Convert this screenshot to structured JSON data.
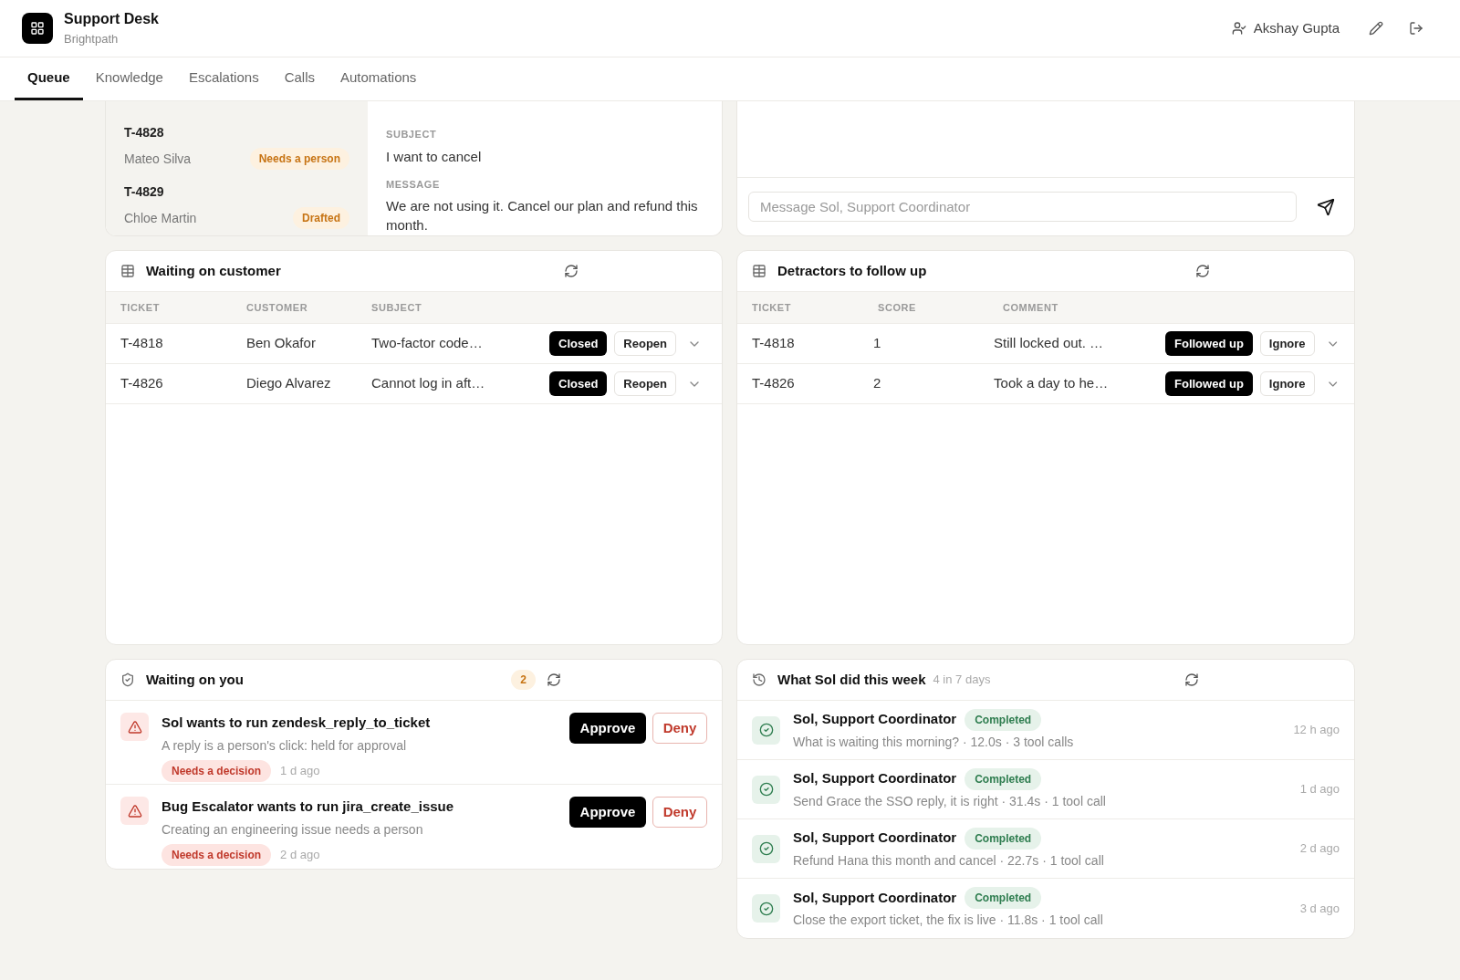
{
  "app": {
    "title": "Support Desk",
    "subtitle": "Brightpath"
  },
  "user": {
    "name": "Akshay Gupta"
  },
  "tabs": [
    {
      "label": "Queue",
      "selected": true
    },
    {
      "label": "Knowledge",
      "selected": false
    },
    {
      "label": "Escalations",
      "selected": false
    },
    {
      "label": "Calls",
      "selected": false
    },
    {
      "label": "Automations",
      "selected": false
    }
  ],
  "ticket_list": [
    {
      "id": "T-4828",
      "customer": "Mateo Silva",
      "status": "Needs a person"
    },
    {
      "id": "T-4829",
      "customer": "Chloe Martin",
      "status": "Drafted"
    }
  ],
  "ticket_detail": {
    "fields": [
      {
        "label": "SUBJECT",
        "value": "I want to cancel"
      },
      {
        "label": "MESSAGE",
        "value": "We are not using it. Cancel our plan and refund this month."
      }
    ]
  },
  "chat": {
    "placeholder": "Message Sol, Support Coordinator"
  },
  "tables": [
    {
      "title": "Waiting on customer",
      "columns": [
        "TICKET",
        "CUSTOMER",
        "SUBJECT"
      ],
      "rows": [
        {
          "cells": [
            "T-4818",
            "Ben Okafor",
            "Two-factor code…"
          ],
          "status": "Closed",
          "action": "Reopen"
        },
        {
          "cells": [
            "T-4826",
            "Diego Alvarez",
            "Cannot log in aft…"
          ],
          "status": "Closed",
          "action": "Reopen"
        }
      ]
    },
    {
      "title": "Detractors to follow up",
      "columns": [
        "TICKET",
        "SCORE",
        "COMMENT"
      ],
      "rows": [
        {
          "cells": [
            "T-4818",
            "1",
            "Still locked out. …"
          ],
          "status": "Followed up",
          "action": "Ignore"
        },
        {
          "cells": [
            "T-4826",
            "2",
            "Took a day to he…"
          ],
          "status": "Followed up",
          "action": "Ignore"
        }
      ]
    }
  ],
  "waiting_on_you": {
    "title": "Waiting on you",
    "count": "2",
    "items": [
      {
        "title": "Sol wants to run zendesk_reply_to_ticket",
        "description": "A reply is a person's click: held for approval",
        "tag": "Needs a decision",
        "time": "1 d ago",
        "approve": "Approve",
        "deny": "Deny"
      },
      {
        "title": "Bug Escalator wants to run jira_create_issue",
        "description": "Creating an engineering issue needs a person",
        "tag": "Needs a decision",
        "time": "2 d ago",
        "approve": "Approve",
        "deny": "Deny"
      }
    ]
  },
  "activity": {
    "title": "What Sol did this week",
    "summary": "4 in 7 days",
    "items": [
      {
        "agent": "Sol, Support Coordinator",
        "status": "Completed",
        "detail": "What is waiting this morning? · 12.0s · 3 tool calls",
        "time": "12 h ago"
      },
      {
        "agent": "Sol, Support Coordinator",
        "status": "Completed",
        "detail": "Send Grace the SSO reply, it is right · 31.4s · 1 tool call",
        "time": "1 d ago"
      },
      {
        "agent": "Sol, Support Coordinator",
        "status": "Completed",
        "detail": "Refund Hana this month and cancel · 22.7s · 1 tool call",
        "time": "2 d ago"
      },
      {
        "agent": "Sol, Support Coordinator",
        "status": "Completed",
        "detail": "Close the export ticket, the fix is live · 11.8s · 1 tool call",
        "time": "3 d ago"
      }
    ]
  }
}
